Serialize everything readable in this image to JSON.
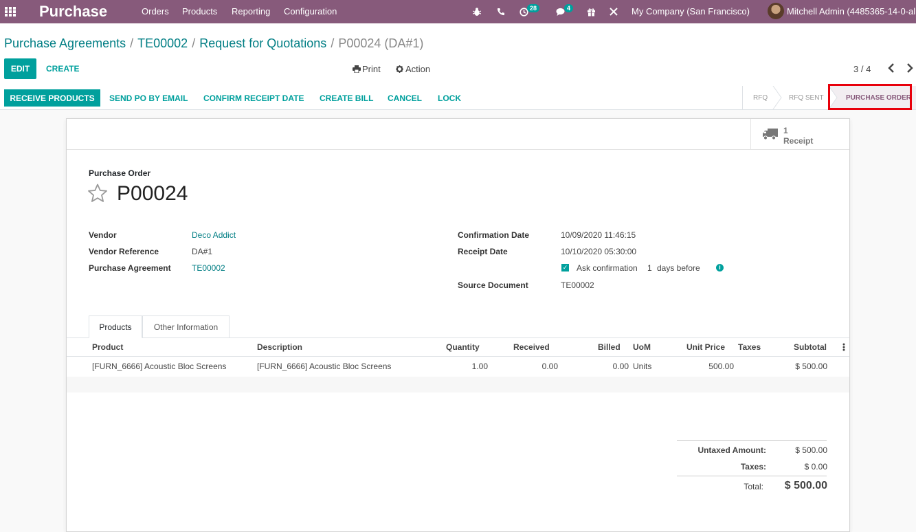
{
  "navbar": {
    "app_name": "Purchase",
    "menus": [
      "Orders",
      "Products",
      "Reporting",
      "Configuration"
    ],
    "activity_count": "28",
    "message_count": "4",
    "company": "My Company (San Francisco)",
    "user": "Mitchell Admin (4485365-14-0-al",
    "bg_color": "#875a7b"
  },
  "breadcrumb": {
    "items": [
      "Purchase Agreements",
      "TE00002",
      "Request for Quotations"
    ],
    "current": "P00024 (DA#1)"
  },
  "control": {
    "edit_label": "EDIT",
    "create_label": "CREATE",
    "print_label": "Print",
    "action_label": "Action",
    "pager": "3 / 4"
  },
  "statusbar": {
    "buttons": [
      "RECEIVE PRODUCTS",
      "SEND PO BY EMAIL",
      "CONFIRM RECEIPT DATE",
      "CREATE BILL",
      "CANCEL",
      "LOCK"
    ],
    "stages": [
      "RFQ",
      "RFQ SENT",
      "PURCHASE ORDER"
    ],
    "active_stage": "PURCHASE ORDER",
    "accent_color": "#00a09d"
  },
  "smart_button": {
    "count": "1",
    "label": "Receipt"
  },
  "form": {
    "doc_label": "Purchase Order",
    "name": "P00024",
    "left_fields": [
      {
        "label": "Vendor",
        "value": "Deco Addict"
      },
      {
        "label": "Vendor Reference",
        "value": "DA#1"
      },
      {
        "label": "Purchase Agreement",
        "value": "TE00002"
      }
    ],
    "right_fields": [
      {
        "label": "Confirmation Date",
        "value": "10/09/2020 11:46:15"
      },
      {
        "label": "Receipt Date",
        "value": "10/10/2020 05:30:00"
      },
      {
        "label": "Source Document",
        "value": "TE00002"
      }
    ],
    "ask_confirmation": {
      "text_before": "Ask confirmation",
      "days": "1",
      "text_after": "days before"
    }
  },
  "tabs": [
    "Products",
    "Other Information"
  ],
  "order_lines": {
    "columns": [
      "Product",
      "Description",
      "Quantity",
      "Received",
      "Billed",
      "UoM",
      "Unit Price",
      "Taxes",
      "Subtotal"
    ],
    "rows": [
      {
        "product": "[FURN_6666] Acoustic Bloc Screens",
        "description": "[FURN_6666] Acoustic Bloc Screens",
        "quantity": "1.00",
        "received": "0.00",
        "billed": "0.00",
        "uom": "Units",
        "unit_price": "500.00",
        "taxes": "",
        "subtotal": "$ 500.00"
      }
    ]
  },
  "totals": {
    "untaxed_label": "Untaxed Amount:",
    "untaxed_value": "$ 500.00",
    "taxes_label": "Taxes:",
    "taxes_value": "$ 0.00",
    "total_label": "Total:",
    "total_value": "$ 500.00"
  }
}
